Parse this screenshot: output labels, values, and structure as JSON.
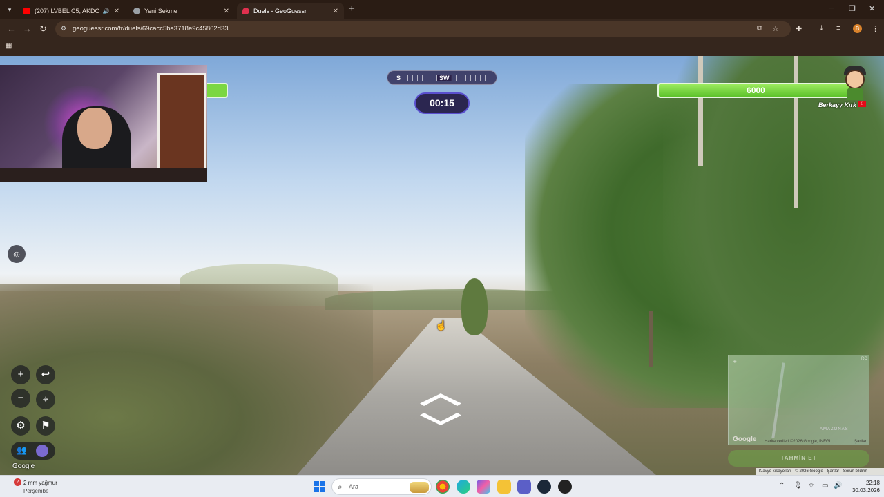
{
  "browser": {
    "tabs": [
      {
        "title": "(207) LVBEL C5, AKDO - CO",
        "favicon_color": "#ff0000",
        "active": false
      },
      {
        "title": "Yeni Sekme",
        "favicon_color": "#9aa0a6",
        "active": false
      },
      {
        "title": "Duels - GeoGuessr",
        "favicon_color": "#e0304e",
        "active": true
      }
    ],
    "url": "geoguessr.com/tr/duels/69cacc5ba3718e9c45862d33",
    "profile_initial": "B"
  },
  "game": {
    "compass": {
      "left": "S",
      "center": "SW"
    },
    "timer": "00:15",
    "opponent": {
      "health": "6000",
      "name": "Berkayy Kırk"
    },
    "minimap": {
      "region_label": "AMAZONAS",
      "corner_label": "RO",
      "attribution": "Harita verileri ©2026 Google, INEGI",
      "terms": "Şartlar"
    },
    "guess_button": "TAHMİN ET",
    "streetview_footer": {
      "shortcuts": "Klavye kısayolları",
      "copyright": "© 2026 Google",
      "terms": "Şartlar",
      "report": "Sorun bildirin"
    },
    "google_label": "Google"
  },
  "taskbar": {
    "weather": {
      "badge": "2",
      "line1": "2 mm yağmur",
      "line2": "Perşembe"
    },
    "search_placeholder": "Ara",
    "time": "22:18",
    "date": "30.03.2026"
  },
  "colors": {
    "health_green": "#5dc22b",
    "timer_border": "#5a4fcf",
    "chrome_bg": "#35261d"
  }
}
